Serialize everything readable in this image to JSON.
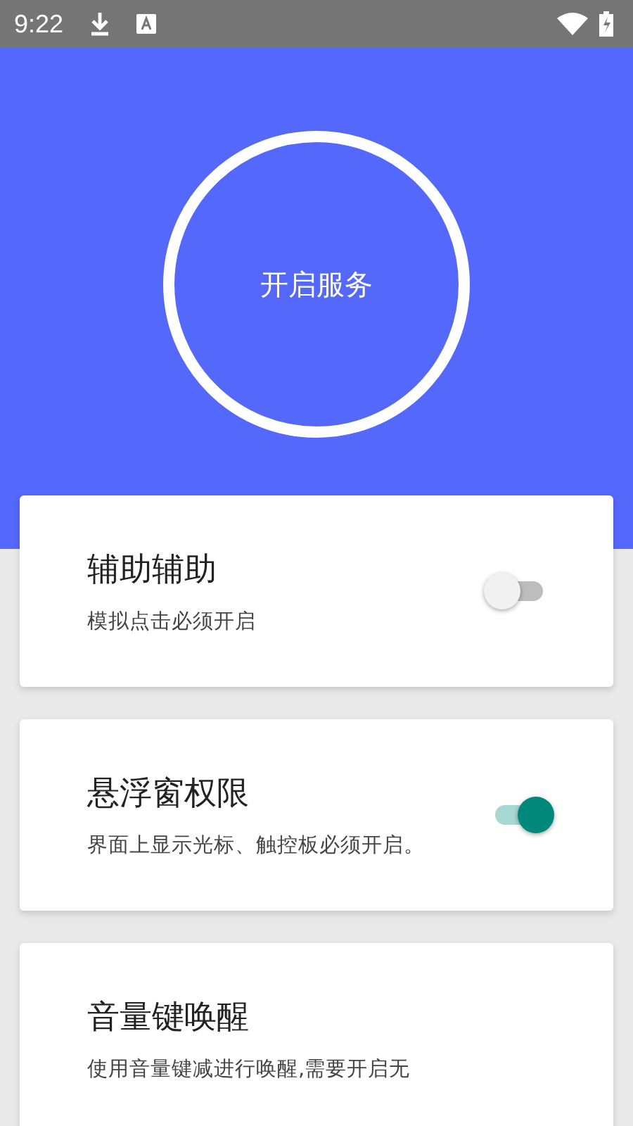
{
  "status_bar": {
    "time": "9:22"
  },
  "service_button": {
    "label": "开启服务"
  },
  "cards": [
    {
      "title": "辅助辅助",
      "subtitle": "模拟点击必须开启",
      "on": false
    },
    {
      "title": "悬浮窗权限",
      "subtitle": "界面上显示光标、触控板必须开启。",
      "on": true
    },
    {
      "title": "音量键唤醒",
      "subtitle": "使用音量键减进行唤醒,需要开启无"
    }
  ]
}
